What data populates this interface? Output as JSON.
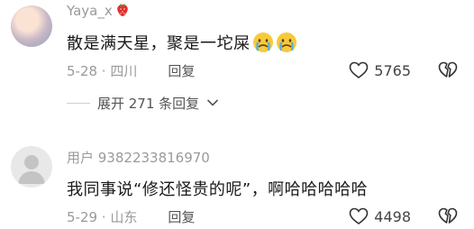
{
  "comments": [
    {
      "username": "Yaya_x",
      "badge_icon": "strawberry-icon",
      "text": "散是满天星，聚是一坨屎",
      "emoji_icons": [
        "crying-face-icon",
        "crying-face-icon"
      ],
      "date_location": "5-28 · 四川",
      "reply_label": "回复",
      "like_count": "5765",
      "expand_replies": "展开 271 条回复"
    },
    {
      "username": "用户 9382233816970",
      "text": "我同事说“修还怪贵的呢”，啊哈哈哈哈哈",
      "date_location": "5-29 · 山东",
      "reply_label": "回复",
      "like_count": "4498"
    }
  ],
  "colors": {
    "meta_text": "#9a9a9a",
    "body_text": "#1a1a1a",
    "icon_stroke": "#333333"
  }
}
